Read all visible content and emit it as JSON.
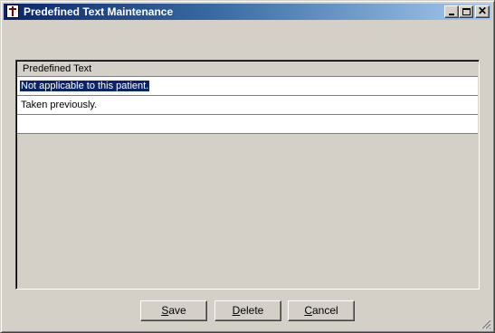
{
  "window": {
    "title": "Predefined Text Maintenance",
    "icon": "caduceus-app-icon"
  },
  "titlebar_buttons": {
    "minimize": "minimize",
    "maximize": "maximize",
    "close": "✕"
  },
  "grid": {
    "column_header": "Predefined Text",
    "rows": [
      {
        "text": "Not applicable to this patient.",
        "selected": true
      },
      {
        "text": "Taken previously.",
        "selected": false
      },
      {
        "text": "",
        "selected": false
      }
    ]
  },
  "buttons": {
    "save": {
      "mnemonic": "S",
      "rest": "ave"
    },
    "delete": {
      "mnemonic": "D",
      "rest": "elete"
    },
    "cancel": {
      "mnemonic": "C",
      "rest": "ancel"
    }
  },
  "colors": {
    "face": "#d4d0c8",
    "title_start": "#0a246a",
    "title_end": "#a6caf0",
    "selection": "#0a246a"
  }
}
